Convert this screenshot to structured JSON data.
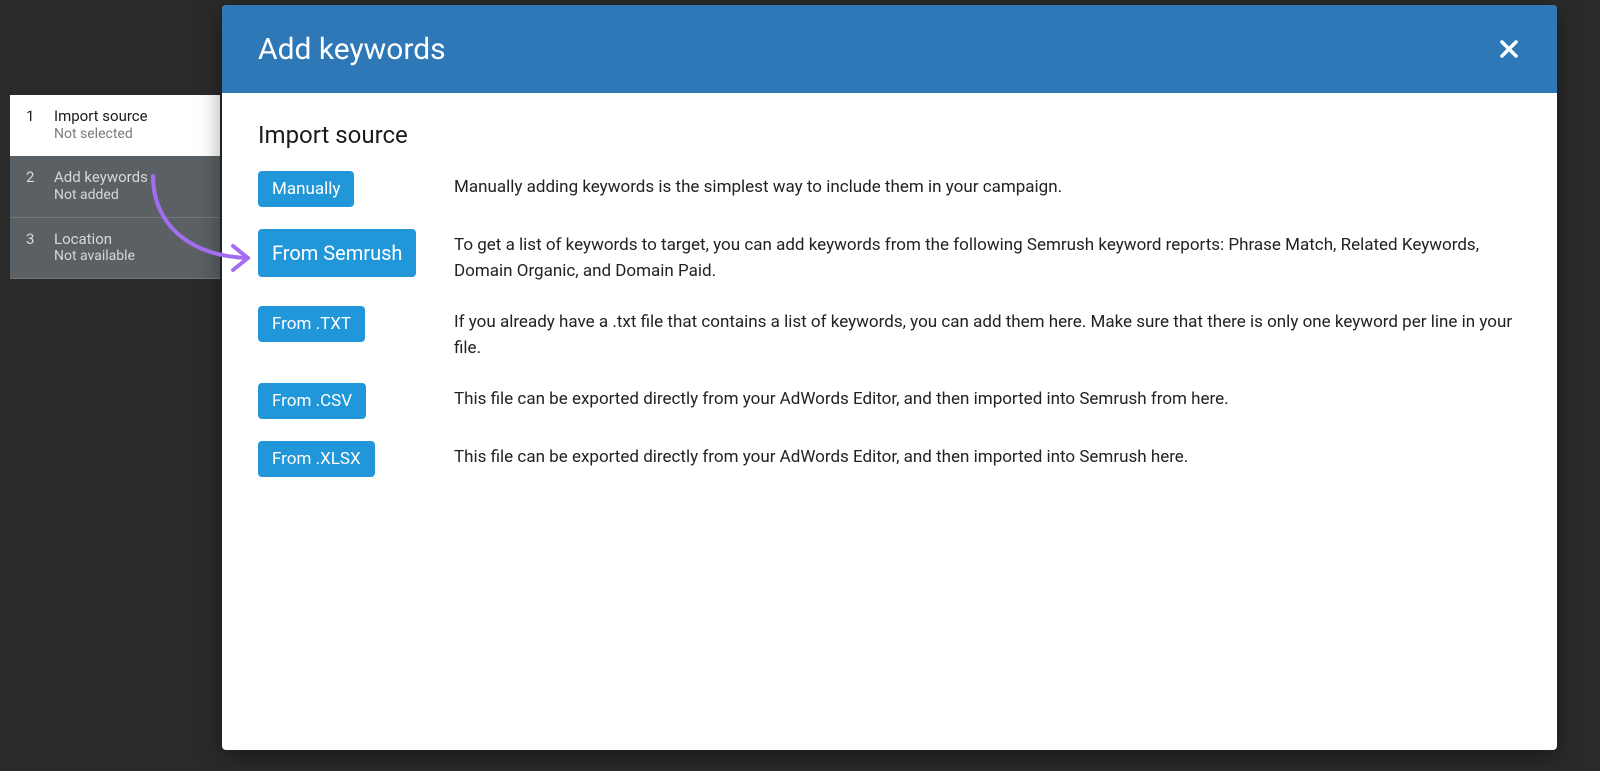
{
  "sidebar": {
    "steps": [
      {
        "num": "1",
        "title": "Import source",
        "sub": "Not selected",
        "active": true
      },
      {
        "num": "2",
        "title": "Add keywords",
        "sub": "Not added",
        "active": false
      },
      {
        "num": "3",
        "title": "Location",
        "sub": "Not available",
        "active": false
      }
    ]
  },
  "modal": {
    "title": "Add keywords",
    "section_title": "Import source",
    "options": [
      {
        "label": "Manually",
        "desc": "Manually adding keywords is the simplest way to include them in your campaign.",
        "highlight": false
      },
      {
        "label": "From Semrush",
        "desc": "To get a list of keywords to target, you can add keywords from the following Semrush keyword reports: Phrase Match, Related Keywords, Domain Organic, and Domain Paid.",
        "highlight": true
      },
      {
        "label": "From .TXT",
        "desc": "If you already have a .txt file that contains a list of keywords, you can add them here. Make sure that there is only one keyword per line in your file.",
        "highlight": false
      },
      {
        "label": "From .CSV",
        "desc": "This file can be exported directly from your AdWords Editor, and then imported into Semrush from here.",
        "highlight": false
      },
      {
        "label": "From .XLSX",
        "desc": "This file can be exported directly from your AdWords Editor, and then imported into Semrush here.",
        "highlight": false
      }
    ]
  }
}
